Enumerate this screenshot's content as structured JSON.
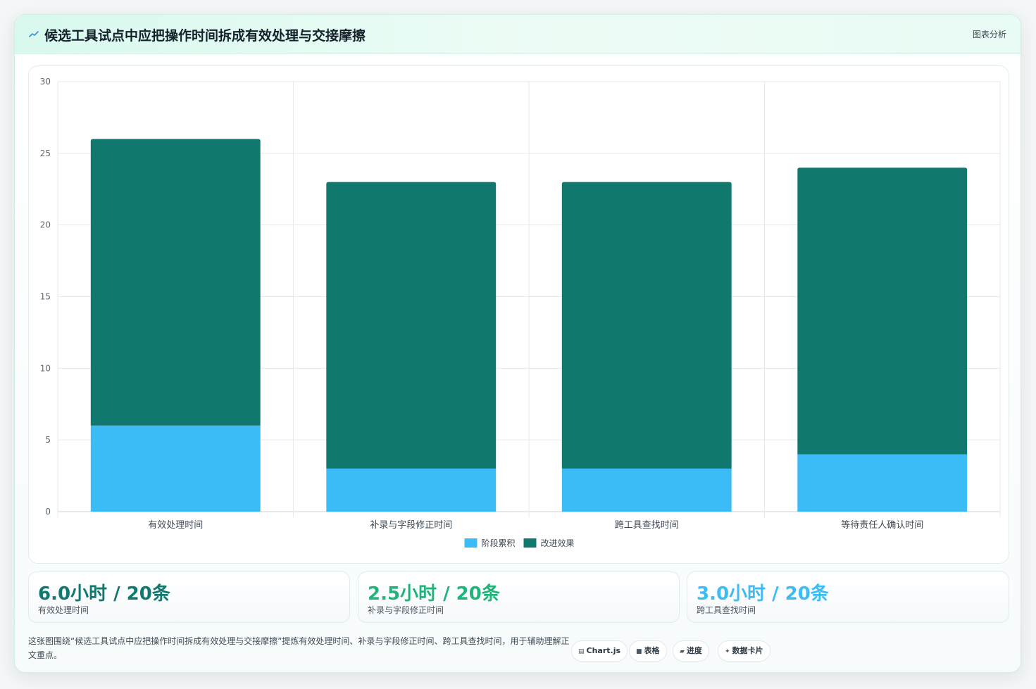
{
  "header": {
    "title": "候选工具试点中应把操作时间拆成有效处理与交接摩擦",
    "link_label": "图表分析"
  },
  "chart_data": {
    "type": "bar",
    "stacked": true,
    "categories": [
      "有效处理时间",
      "补录与字段修正时间",
      "跨工具查找时间",
      "等待责任人确认时间"
    ],
    "series": [
      {
        "name": "阶段累积",
        "color": "#3bbcf6",
        "values": [
          6,
          3,
          3,
          4
        ]
      },
      {
        "name": "改进效果",
        "color": "#11786f",
        "values": [
          20,
          20,
          20,
          20
        ]
      }
    ],
    "ylim": [
      0,
      30
    ],
    "yticks": [
      "0",
      "5",
      "10",
      "15",
      "20",
      "25",
      "30"
    ],
    "grid": true,
    "legend_position": "bottom"
  },
  "stats": [
    {
      "value": "6.0小时 / 20条",
      "label": "有效处理时间",
      "color": "#11786f"
    },
    {
      "value": "2.5小时 / 20条",
      "label": "补录与字段修正时间",
      "color": "#1fb57a"
    },
    {
      "value": "3.0小时 / 20条",
      "label": "跨工具查找时间",
      "color": "#3bbcf6"
    }
  ],
  "description": "这张图围绕“候选工具试点中应把操作时间拆成有效处理与交接摩擦”提炼有效处理时间、补录与字段修正时间、跨工具查找时间，用于辅助理解正文重点。",
  "tags": [
    {
      "icon": "chart-icon",
      "label": "Chart.js"
    },
    {
      "icon": "table-icon",
      "label": "表格"
    },
    {
      "icon": "progress-icon",
      "label": "进度"
    },
    {
      "icon": "sparkle-icon",
      "label": "数据卡片"
    }
  ]
}
